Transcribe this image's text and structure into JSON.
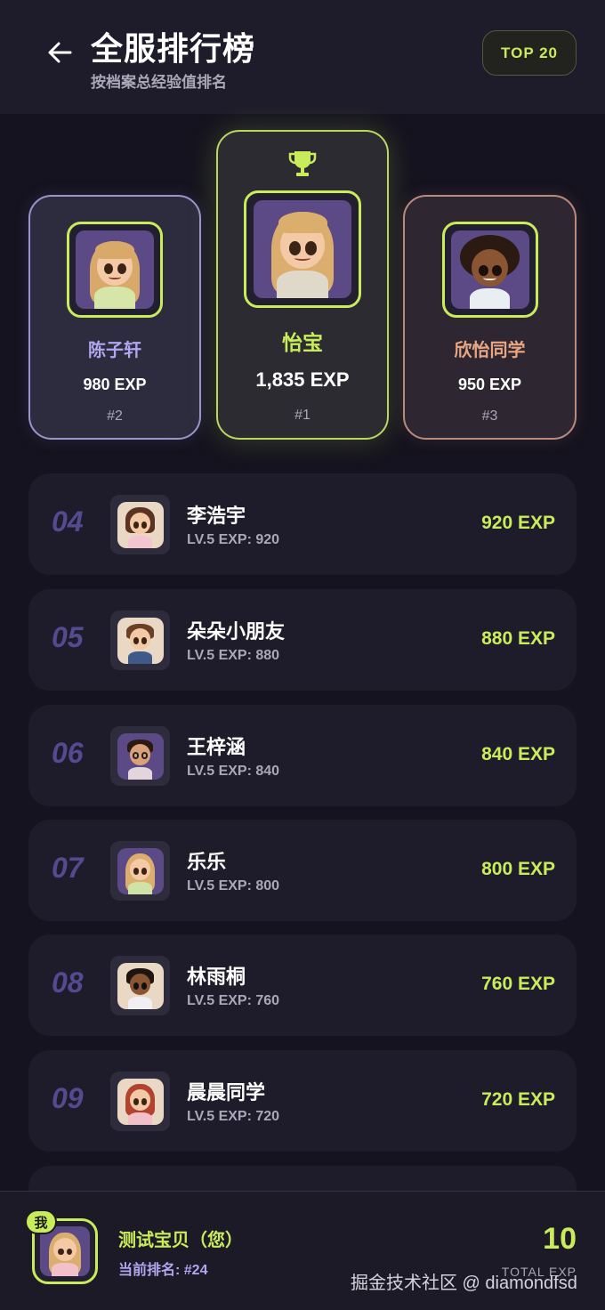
{
  "header": {
    "title": "全服排行榜",
    "subtitle": "按档案总经验值排名",
    "badge": "TOP 20"
  },
  "podium": {
    "first": {
      "name": "怡宝",
      "exp": "1,835 EXP",
      "rank": "#1"
    },
    "second": {
      "name": "陈子轩",
      "exp": "980 EXP",
      "rank": "#2"
    },
    "third": {
      "name": "欣怡同学",
      "exp": "950 EXP",
      "rank": "#3"
    }
  },
  "list": [
    {
      "rank": "04",
      "name": "李浩宇",
      "meta": "LV.5  EXP: 920",
      "exp": "920 EXP"
    },
    {
      "rank": "05",
      "name": "朵朵小朋友",
      "meta": "LV.5  EXP: 880",
      "exp": "880 EXP"
    },
    {
      "rank": "06",
      "name": "王梓涵",
      "meta": "LV.5  EXP: 840",
      "exp": "840 EXP"
    },
    {
      "rank": "07",
      "name": "乐乐",
      "meta": "LV.5  EXP: 800",
      "exp": "800 EXP"
    },
    {
      "rank": "08",
      "name": "林雨桐",
      "meta": "LV.5  EXP: 760",
      "exp": "760 EXP"
    },
    {
      "rank": "09",
      "name": "晨晨同学",
      "meta": "LV.5  EXP: 720",
      "exp": "720 EXP"
    }
  ],
  "me": {
    "badge": "我",
    "name": "测试宝贝（您）",
    "rank": "当前排名: #24",
    "total": "10",
    "total_label": "TOTAL EXP"
  },
  "watermark": "掘金技术社区 @ diamondfsd",
  "colors": {
    "accent": "#c8ec5a",
    "second": "#b1a7f0",
    "third": "#e8a682",
    "background": "#15131f"
  }
}
